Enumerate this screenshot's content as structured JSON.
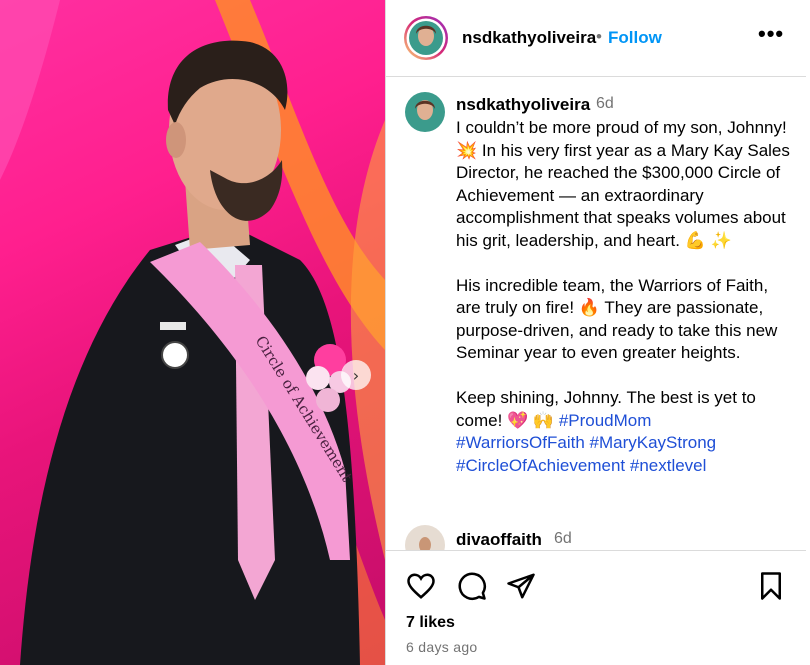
{
  "post": {
    "username": "nsdkathyoliveira",
    "follow_label": "Follow",
    "more_label": "•••",
    "caption_time": "6d",
    "caption_paragraphs": [
      "I couldn’t be more proud of my son, Johnny! 💥 In his very first year as a Mary Kay Sales Director, he reached the $300,000 Circle of Achievement — an extraordinary accomplishment that speaks volumes about his grit, leadership, and heart. 💪 ✨",
      "His incredible team, the Warriors of Faith, are truly on fire! 🔥 They are passionate, purpose-driven, and ready to take this new Seminar year to even greater heights.",
      "Keep shining, Johnny. The best is yet to come! 💖 🙌"
    ],
    "hashtags": [
      "#ProudMom",
      "#WarriorsOfFaith",
      "#MaryKayStrong",
      "#CircleOfAchievement",
      "#nextlevel"
    ],
    "likes": "7 likes",
    "posted_ago": "6 days ago"
  },
  "media": {
    "sash_text": "Circle of Achievement",
    "next_glyph": "›"
  },
  "comment": {
    "username": "divaoffaith",
    "time": "6d"
  },
  "colors": {
    "follow": "#0095f6",
    "hashtag": "#1f4fd6",
    "background_pink": "#ff1f8e",
    "sash_pink": "#f59ad3"
  },
  "icons": [
    "heart-icon",
    "comment-icon",
    "share-icon",
    "bookmark-icon",
    "more-icon",
    "carousel-next-icon"
  ]
}
